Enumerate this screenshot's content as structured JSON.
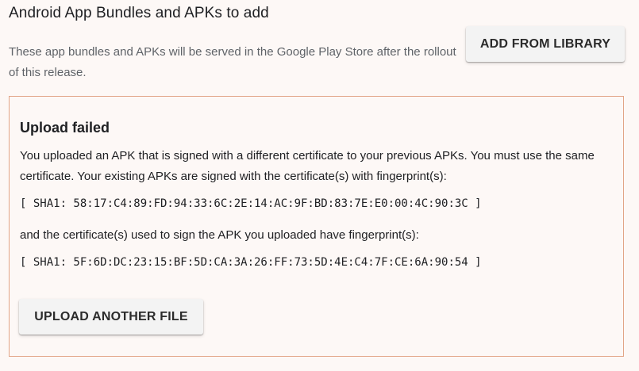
{
  "section": {
    "title": "Android App Bundles and APKs to add",
    "description": "These app bundles and APKs will be served in the Google Play Store after the rollout of this release.",
    "add_button_label": "ADD FROM LIBRARY"
  },
  "error_panel": {
    "title": "Upload failed",
    "message_existing": "You uploaded an APK that is signed with a different certificate to your previous APKs. You must use the same certificate. Your existing APKs are signed with the certificate(s) with fingerprint(s):",
    "fingerprint_existing": "[ SHA1: 58:17:C4:89:FD:94:33:6C:2E:14:AC:9F:BD:83:7E:E0:00:4C:90:3C ]",
    "message_uploaded": "and the certificate(s) used to sign the APK you uploaded have fingerprint(s):",
    "fingerprint_uploaded": "[ SHA1: 5F:6D:DC:23:15:BF:5D:CA:3A:26:FF:73:5D:4E:C4:7F:CE:6A:90:54 ]",
    "upload_button_label": "UPLOAD ANOTHER FILE"
  },
  "colors": {
    "background": "#fdf8f6",
    "panel_border": "#e2a587",
    "text_primary": "#202124",
    "text_secondary": "#5f6368",
    "button_bg": "#f3f3f3"
  }
}
